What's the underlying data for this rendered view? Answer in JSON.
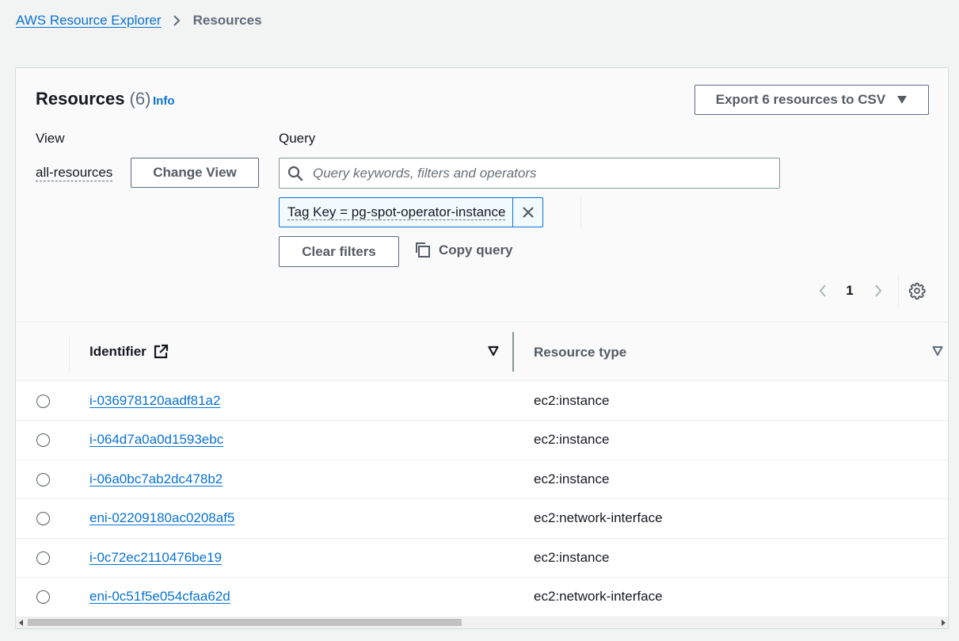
{
  "breadcrumb": {
    "root": "AWS Resource Explorer",
    "current": "Resources"
  },
  "header": {
    "title": "Resources",
    "count": "(6)",
    "info": "Info",
    "export_button": "Export 6 resources to CSV"
  },
  "view": {
    "label": "View",
    "value": "all-resources",
    "change_button": "Change View"
  },
  "query": {
    "label": "Query",
    "placeholder": "Query keywords, filters and operators",
    "value": "",
    "token": "Tag Key = pg-spot-operator-instance",
    "clear_button": "Clear filters",
    "copy_button": "Copy query"
  },
  "pagination": {
    "current_page": "1"
  },
  "table": {
    "columns": [
      "Identifier",
      "Resource type"
    ],
    "rows": [
      {
        "identifier": "i-036978120aadf81a2",
        "type": "ec2:instance"
      },
      {
        "identifier": "i-064d7a0a0d1593ebc",
        "type": "ec2:instance"
      },
      {
        "identifier": "i-06a0bc7ab2dc478b2",
        "type": "ec2:instance"
      },
      {
        "identifier": "eni-02209180ac0208af5",
        "type": "ec2:network-interface"
      },
      {
        "identifier": "i-0c72ec2110476be19",
        "type": "ec2:instance"
      },
      {
        "identifier": "eni-0c51f5e054cfaa62d",
        "type": "ec2:network-interface"
      }
    ]
  },
  "colors": {
    "link": "#0972d3",
    "text": "#16191f",
    "muted": "#5f6b7a",
    "background": "#f2f3f3"
  }
}
